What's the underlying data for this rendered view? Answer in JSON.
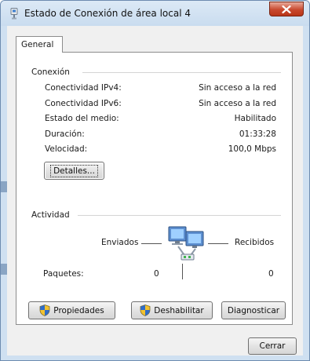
{
  "window": {
    "title": "Estado de Conexión de área local 4",
    "close_glyph": "X"
  },
  "tabs": [
    {
      "label": "General",
      "selected": true
    }
  ],
  "connection": {
    "group_label": "Conexión",
    "rows": [
      {
        "label": "Conectividad IPv4:",
        "value": "Sin acceso a la red"
      },
      {
        "label": "Conectividad IPv6:",
        "value": "Sin acceso a la red"
      },
      {
        "label": "Estado del medio:",
        "value": "Habilitado"
      },
      {
        "label": "Duración:",
        "value": "01:33:28"
      },
      {
        "label": "Velocidad:",
        "value": "100,0 Mbps"
      }
    ],
    "details_button": "Detalles..."
  },
  "activity": {
    "group_label": "Actividad",
    "sent_label": "Enviados",
    "received_label": "Recibidos",
    "packets_label": "Paquetes:",
    "packets_sent": "0",
    "packets_received": "0"
  },
  "buttons": {
    "properties": "Propiedades",
    "disable": "Deshabilitar",
    "diagnose": "Diagnosticar",
    "close": "Cerrar"
  },
  "icons": {
    "title": "network-adapter-icon",
    "activity": "network-computers-icon",
    "shield": "uac-shield-icon"
  },
  "colors": {
    "title_bar": "#c9dcef",
    "close_button": "#c8492e",
    "dialog_background": "#f0f0f0",
    "panel_background": "#ffffff"
  }
}
